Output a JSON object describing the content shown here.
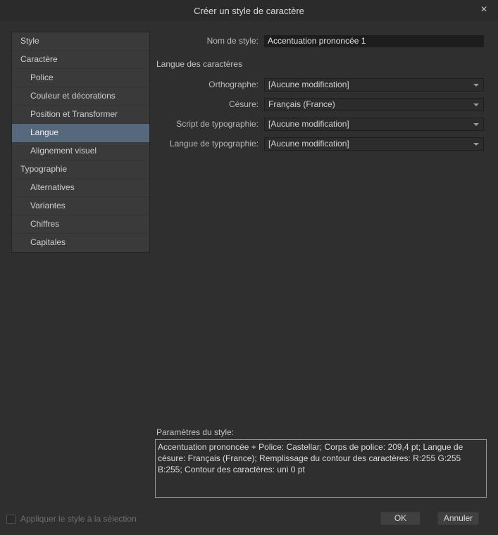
{
  "dialog": {
    "title": "Créer un style de caractère",
    "close_glyph": "×"
  },
  "sidebar": {
    "selected": "Langue",
    "items": [
      {
        "label": "Style"
      },
      {
        "label": "Caractère"
      },
      {
        "label": "Police"
      },
      {
        "label": "Couleur et décorations"
      },
      {
        "label": "Position et Transformer"
      },
      {
        "label": "Langue"
      },
      {
        "label": "Alignement visuel"
      },
      {
        "label": "Typographie"
      },
      {
        "label": "Alternatives"
      },
      {
        "label": "Variantes"
      },
      {
        "label": "Chiffres"
      },
      {
        "label": "Capitales"
      }
    ]
  },
  "form": {
    "name_label": "Nom de style:",
    "name_value": "Accentuation prononcée 1",
    "section_heading": "Langue des caractères",
    "fields": [
      {
        "label": "Orthographe:",
        "value": "[Aucune modification]"
      },
      {
        "label": "Césure:",
        "value": "Français (France)"
      },
      {
        "label": "Script de typographie:",
        "value": "[Aucune modification]"
      },
      {
        "label": "Langue de typographie:",
        "value": "[Aucune modification]"
      }
    ]
  },
  "settings": {
    "label": "Paramètres du style:",
    "text": "Accentuation prononcée + Police: Castellar; Corps de police: 209,4 pt; Langue de césure: Français (France); Remplissage du contour des caractères: R:255 G:255 B:255; Contour des caractères: uni 0 pt"
  },
  "footer": {
    "checkbox_label": "Appliquer le style à la sélection",
    "ok_label": "OK",
    "cancel_label": "Annuler"
  },
  "colors": {
    "selection": "#56687c",
    "dialog_bg": "#2f2f2f",
    "input_bg": "#1d1d1d"
  }
}
